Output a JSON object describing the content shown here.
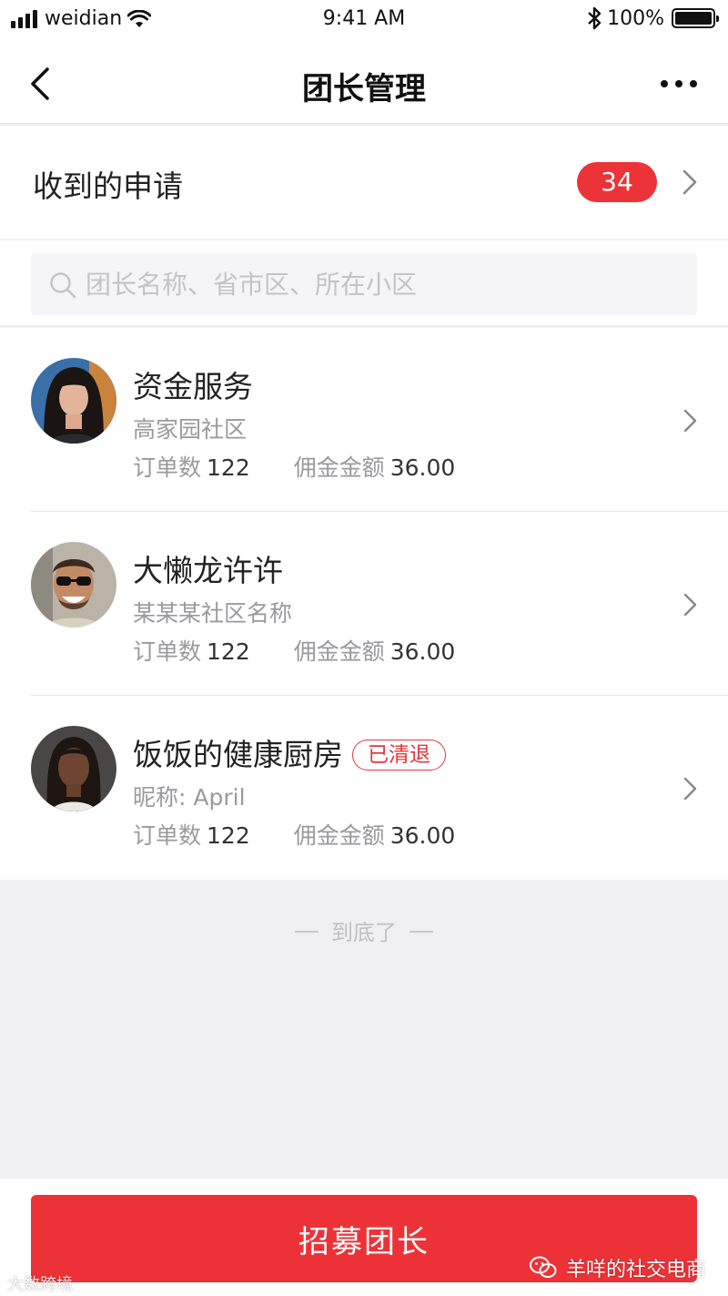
{
  "status_bar": {
    "carrier": "weidian",
    "time": "9:41 AM",
    "battery_percent": "100%",
    "icons": [
      "signal-icon",
      "wifi-icon",
      "bluetooth-icon",
      "battery-icon"
    ]
  },
  "nav": {
    "title": "团长管理",
    "back_icon": "chevron-left-icon",
    "more_icon": "more-dots-icon"
  },
  "applications": {
    "label": "收到的申请",
    "count": "34"
  },
  "search": {
    "placeholder": "团长名称、省市区、所在小区",
    "value": ""
  },
  "leaders": [
    {
      "name": "资金服务",
      "subtitle": "高家园社区",
      "orders_label": "订单数",
      "orders": "122",
      "commission_label": "佣金金额",
      "commission": "36.00"
    },
    {
      "name": "大懒龙许许",
      "subtitle": "某某某社区名称",
      "orders_label": "订单数",
      "orders": "122",
      "commission_label": "佣金金额",
      "commission": "36.00"
    },
    {
      "name": "饭饭的健康厨房",
      "tag": "已清退",
      "subtitle": "昵称: April",
      "orders_label": "订单数",
      "orders": "122",
      "commission_label": "佣金金额",
      "commission": "36.00"
    }
  ],
  "end_text": "到底了",
  "recruit_button": "招募团长",
  "watermarks": {
    "left": "大数跨境",
    "right": "羊咩的社交电商"
  },
  "colors": {
    "accent_red": "#ed3237",
    "muted_text": "#9a9a9e",
    "page_bg": "#f0f0f2"
  }
}
